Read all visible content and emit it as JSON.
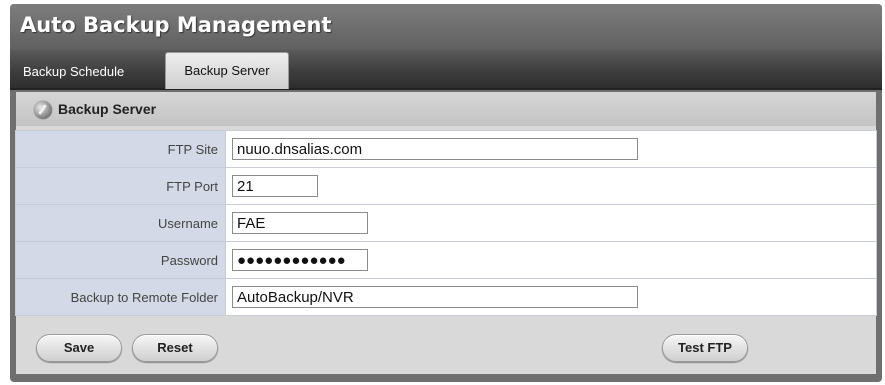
{
  "window": {
    "title": "Auto Backup Management"
  },
  "tabs": [
    {
      "label": "Backup Schedule",
      "active": false
    },
    {
      "label": "Backup Server",
      "active": true
    }
  ],
  "section": {
    "title": "Backup Server",
    "icon": "server-gear-icon"
  },
  "form": {
    "ftp_site": {
      "label": "FTP Site",
      "value": "nuuo.dnsalias.com"
    },
    "ftp_port": {
      "label": "FTP Port",
      "value": "21"
    },
    "username": {
      "label": "Username",
      "value": "FAE"
    },
    "password": {
      "label": "Password",
      "value": "●●●●●●●●●●●●"
    },
    "remote_folder": {
      "label": "Backup to Remote Folder",
      "value": "AutoBackup/NVR"
    }
  },
  "buttons": {
    "save": "Save",
    "reset": "Reset",
    "test_ftp": "Test FTP"
  },
  "colors": {
    "label_bg": "#d3d9e6",
    "panel_bg": "#d9d9d9",
    "title_bar": "#6f6f6f"
  }
}
